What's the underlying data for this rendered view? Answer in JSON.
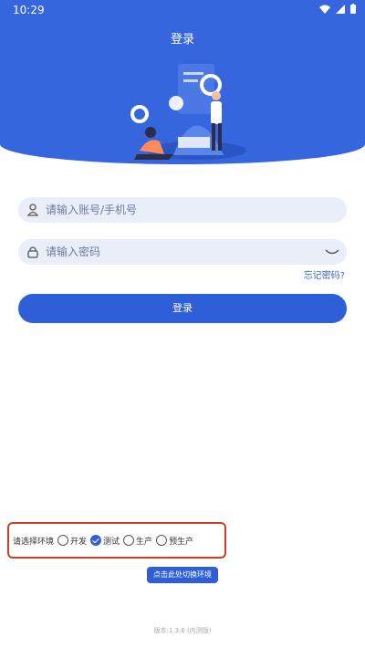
{
  "status_bar": {
    "time": "10:29"
  },
  "header": {
    "title": "登录"
  },
  "form": {
    "account_placeholder": "请输入账号/手机号",
    "password_placeholder": "请输入密码",
    "forgot_label": "忘记密码?",
    "login_label": "登录"
  },
  "environment": {
    "label": "请选择环境",
    "options": [
      {
        "label": "开发",
        "selected": false
      },
      {
        "label": "测试",
        "selected": true
      },
      {
        "label": "生产",
        "selected": false
      },
      {
        "label": "预生产",
        "selected": false
      }
    ],
    "switch_label": "点击此处切换环境"
  },
  "footer": {
    "version": "版本:1.3.8 (内测版)"
  },
  "colors": {
    "primary": "#2f5fd8",
    "hero": "#3566dd",
    "highlight_border": "#d23c20"
  }
}
